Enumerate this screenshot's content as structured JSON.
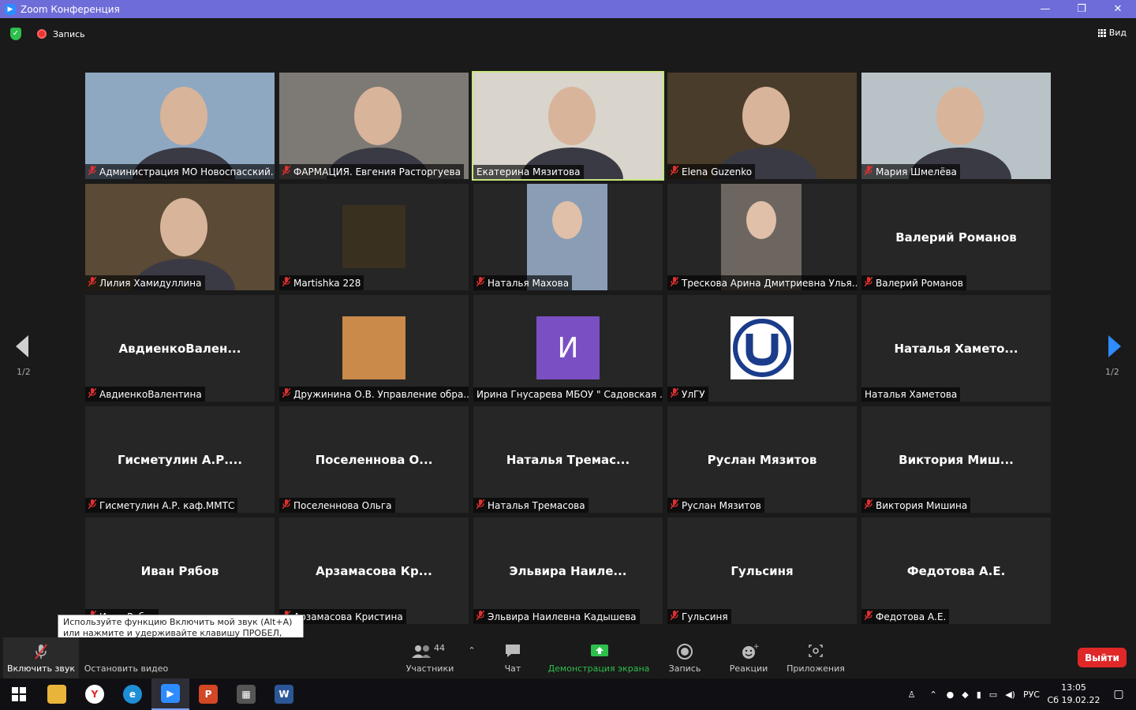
{
  "window": {
    "title": "Zoom Конференция",
    "minimize": "—",
    "restore": "❐",
    "close": "✕"
  },
  "topbar": {
    "record_label": "Запись",
    "view_label": "Вид"
  },
  "pager": {
    "left": "1/2",
    "right": "1/2"
  },
  "tiles": [
    {
      "label": "Администрация МО Новоспасский...",
      "muted": true,
      "kind": "photo",
      "bg": "#8fa8c2"
    },
    {
      "label": "ФАРМАЦИЯ. Евгения Расторгуева",
      "muted": true,
      "kind": "photo",
      "bg": "#7d7a76"
    },
    {
      "label": "Екатерина Мязитова",
      "muted": false,
      "kind": "photo",
      "bg": "#d9d4cc",
      "active": true
    },
    {
      "label": "Elena Guzenko",
      "muted": true,
      "kind": "photo",
      "bg": "#4a3c2a"
    },
    {
      "label": "Мария Шмелёва",
      "muted": true,
      "kind": "photo",
      "bg": "#b9c3c7"
    },
    {
      "label": "Лилия Хамидуллина",
      "muted": true,
      "kind": "photo",
      "bg": "#5a4a36"
    },
    {
      "label": "Martishka 228",
      "muted": true,
      "kind": "avatar",
      "bg": "#2a2a2a",
      "avatar_bg": "#3a3020"
    },
    {
      "label": "Наталья Махова",
      "muted": true,
      "kind": "photo-center",
      "bg": "#8a9db5"
    },
    {
      "label": "Трескова Арина Дмитриевна Улья...",
      "muted": true,
      "kind": "photo-center",
      "bg": "#6d6660"
    },
    {
      "label": "Валерий Романов",
      "muted": true,
      "kind": "name",
      "big": "Валерий Романов"
    },
    {
      "label": "АвдиенкоВалентина",
      "muted": true,
      "kind": "name",
      "big": "АвдиенкоВален..."
    },
    {
      "label": "Дружинина О.В. Управление обра...",
      "muted": true,
      "kind": "avatar",
      "avatar_bg": "#c98a4a"
    },
    {
      "label": "Ирина Гнусарева МБОУ \" Садовская ...",
      "muted": false,
      "kind": "letter",
      "letter": "И",
      "avatar_bg": "#7b4fc4"
    },
    {
      "label": "УлГУ",
      "muted": true,
      "kind": "logo",
      "avatar_bg": "#ffffff"
    },
    {
      "label": "Наталья Хаметова",
      "muted": false,
      "kind": "name",
      "big": "Наталья Хамето..."
    },
    {
      "label": "Гисметулин А.Р. каф.ММТС",
      "muted": true,
      "kind": "name",
      "big": "Гисметулин А.Р...."
    },
    {
      "label": "Поселеннова Ольга",
      "muted": true,
      "kind": "name",
      "big": "Поселеннова О..."
    },
    {
      "label": "Наталья Тремасова",
      "muted": true,
      "kind": "name",
      "big": "Наталья Тремас..."
    },
    {
      "label": "Руслан Мязитов",
      "muted": true,
      "kind": "name",
      "big": "Руслан Мязитов"
    },
    {
      "label": "Виктория Мишина",
      "muted": true,
      "kind": "name",
      "big": "Виктория Миш..."
    },
    {
      "label": "Иван Рябов",
      "muted": true,
      "kind": "name",
      "big": "Иван Рябов"
    },
    {
      "label": "Арзамасова Кристина",
      "muted": true,
      "kind": "name",
      "big": "Арзамасова Кр..."
    },
    {
      "label": "Эльвира Наилевна Кадышева",
      "muted": true,
      "kind": "name",
      "big": "Эльвира Наиле..."
    },
    {
      "label": "Гульсиня",
      "muted": true,
      "kind": "name",
      "big": "Гульсиня"
    },
    {
      "label": "Федотова А.Е.",
      "muted": true,
      "kind": "name",
      "big": "Федотова А.Е."
    }
  ],
  "tooltip": "Используйте функцию Включить мой звук (Alt+A) или нажмите и удерживайте клавишу ПРОБЕЛ, чтобы временно включить звук.",
  "toolbar": {
    "unmute": "Включить звук",
    "video": "Остановить видео",
    "participants": "Участники",
    "participants_count": "44",
    "chat": "Чат",
    "share": "Демонстрация экрана",
    "record": "Запись",
    "reactions": "Реакции",
    "apps": "Приложения",
    "leave": "Выйти"
  },
  "taskbar": {
    "lang": "РУС",
    "time": "13:05",
    "date": "Сб 19.02.22"
  },
  "colors": {
    "accent": "#2d8cff",
    "share_green": "#2dbf4c",
    "leave_red": "#e02828",
    "active_border": "#c6e67c"
  }
}
